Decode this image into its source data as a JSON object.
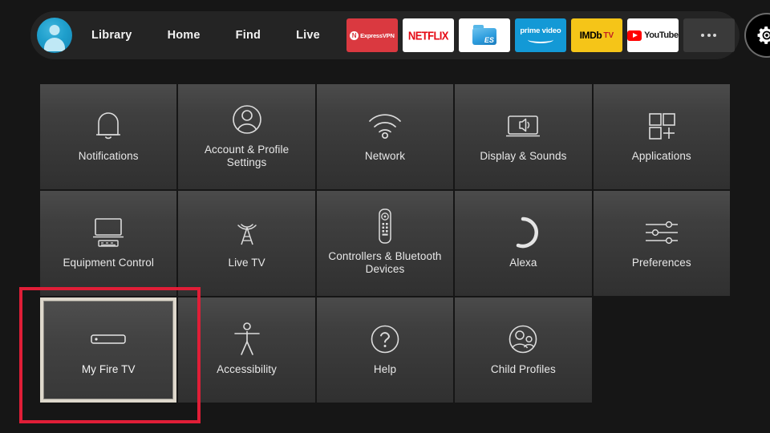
{
  "colors": {
    "background": "#161616",
    "nav_background": "#242424",
    "tile_top": "#4b4b4b",
    "tile_bottom": "#303030",
    "annotation_red": "#e01e37",
    "focus_border": "#ded8cc",
    "avatar_blue": "#1f9fcc",
    "netflix_red": "#e50914",
    "expressvpn_red": "#da3940",
    "prime_blue": "#1399d6",
    "imdb_yellow": "#f5c518",
    "youtube_red": "#ff0000"
  },
  "nav": {
    "avatar": {
      "icon": "user-avatar-icon"
    },
    "links": [
      {
        "label": "Library",
        "name": "nav-link-library"
      },
      {
        "label": "Home",
        "name": "nav-link-home"
      },
      {
        "label": "Find",
        "name": "nav-link-find"
      },
      {
        "label": "Live",
        "name": "nav-link-live"
      }
    ],
    "apps": [
      {
        "name": "app-tile-expressvpn",
        "label": "ExpressVPN",
        "short": "ExpressVPN",
        "badge": "N"
      },
      {
        "name": "app-tile-netflix",
        "label": "NETFLIX"
      },
      {
        "name": "app-tile-es-file-explorer",
        "label": "ES File Explorer",
        "letters": "ES"
      },
      {
        "name": "app-tile-prime-video",
        "label": "prime video"
      },
      {
        "name": "app-tile-imdb-tv",
        "label": "IMDb",
        "suffix": "TV"
      },
      {
        "name": "app-tile-youtube",
        "label": "YouTube"
      }
    ],
    "more_button": {
      "name": "more-apps-button",
      "icon": "ellipsis-icon"
    },
    "settings_button": {
      "name": "settings-gear-button",
      "icon": "gear-icon",
      "focused": true
    }
  },
  "grid": {
    "tiles": [
      {
        "label": "Notifications",
        "icon": "bell-icon",
        "name": "settings-tile-notifications",
        "focused": false
      },
      {
        "label": "Account & Profile Settings",
        "icon": "person-circle-icon",
        "name": "settings-tile-account-profile-settings",
        "focused": false
      },
      {
        "label": "Network",
        "icon": "wifi-icon",
        "name": "settings-tile-network",
        "focused": false
      },
      {
        "label": "Display & Sounds",
        "icon": "tv-speaker-icon",
        "name": "settings-tile-display-sounds",
        "focused": false
      },
      {
        "label": "Applications",
        "icon": "app-grid-plus-icon",
        "name": "settings-tile-applications",
        "focused": false
      },
      {
        "label": "Equipment Control",
        "icon": "tv-remote-equipment-icon",
        "name": "settings-tile-equipment-control",
        "focused": false
      },
      {
        "label": "Live TV",
        "icon": "antenna-tower-icon",
        "name": "settings-tile-live-tv",
        "focused": false
      },
      {
        "label": "Controllers & Bluetooth Devices",
        "icon": "remote-control-icon",
        "name": "settings-tile-controllers-bluetooth-devices",
        "focused": false
      },
      {
        "label": "Alexa",
        "icon": "alexa-ring-icon",
        "name": "settings-tile-alexa",
        "focused": false
      },
      {
        "label": "Preferences",
        "icon": "sliders-icon",
        "name": "settings-tile-preferences",
        "focused": false
      },
      {
        "label": "My Fire TV",
        "icon": "fire-tv-stick-icon",
        "name": "settings-tile-my-fire-tv",
        "focused": true
      },
      {
        "label": "Accessibility",
        "icon": "accessibility-person-icon",
        "name": "settings-tile-accessibility",
        "focused": false
      },
      {
        "label": "Help",
        "icon": "question-circle-icon",
        "name": "settings-tile-help",
        "focused": false
      },
      {
        "label": "Child Profiles",
        "icon": "child-profiles-icon",
        "name": "settings-tile-child-profiles",
        "focused": false
      }
    ]
  },
  "annotation": {
    "name": "highlight-box-my-fire-tv",
    "color": "#e01e37"
  }
}
